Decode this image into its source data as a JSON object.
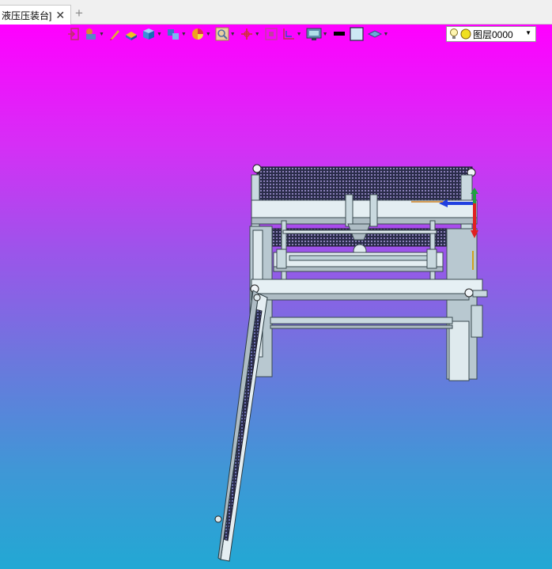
{
  "tab": {
    "label": "液压压装台]",
    "close_glyph": "✕",
    "add_glyph": "+"
  },
  "toolbar": {
    "buttons": [
      "exit-icon",
      "render-mode-icon",
      "pencil-icon",
      "material-icon",
      "cube-icon",
      "view-orient-icon",
      "pie-color-icon",
      "zoom-icon",
      "axis-icon",
      "fit-window-icon",
      "section-icon",
      "display-icon",
      "line-color-icon",
      "fill-color-icon",
      "layer-plane-icon"
    ],
    "layer_select": {
      "value": "图层0000"
    }
  },
  "colors": {
    "bg_top": "#ff00ff",
    "bg_bottom": "#22a8d4",
    "frame": "#c9d9df",
    "frame_dark": "#5a6a70",
    "mesh": "#2a2c4a"
  }
}
